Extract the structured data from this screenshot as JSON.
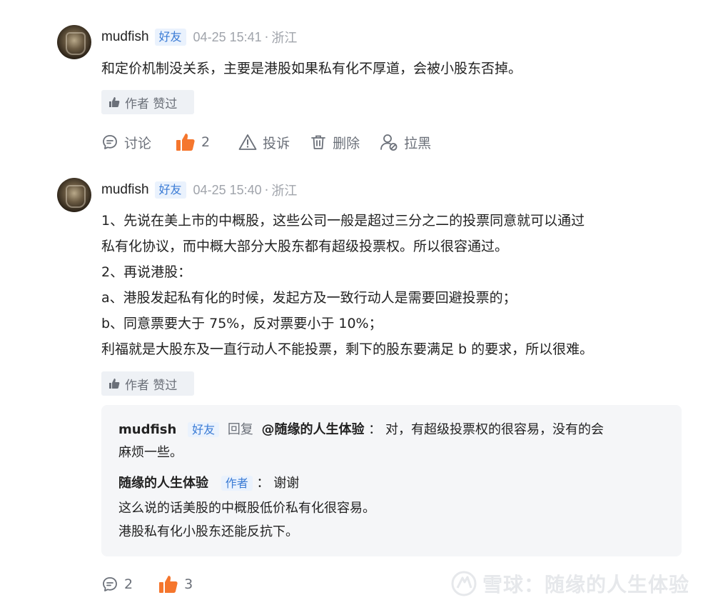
{
  "comments": [
    {
      "username": "mudfish",
      "friend_tag": "好友",
      "timestamp": "04-25 15:41",
      "separator": "·",
      "location": "浙江",
      "lines": [
        "和定价机制没关系，主要是港股如果私有化不厚道，会被小股东否掉。"
      ],
      "author_liked": "作者 赞过",
      "actions": {
        "discuss_label": "讨论",
        "like_count": "2",
        "report_label": "投诉",
        "delete_label": "删除",
        "block_label": "拉黑"
      }
    },
    {
      "username": "mudfish",
      "friend_tag": "好友",
      "timestamp": "04-25 15:40",
      "separator": "·",
      "location": "浙江",
      "lines": [
        "1、先说在美上市的中概股，这些公司一般是超过三分之二的投票同意就可以通过",
        "私有化协议，而中概大部分大股东都有超级投票权。所以很容通过。",
        "2、再说港股：",
        "a、港股发起私有化的时候，发起方及一致行动人是需要回避投票的；",
        "b、同意票要大于 75%，反对票要小于 10%；",
        "利福就是大股东及一直行动人不能投票，剩下的股东要满足 b 的要求，所以很难。"
      ],
      "author_liked": "作者 赞过",
      "replies": [
        {
          "username": "mudfish",
          "friend_tag": "好友",
          "reply_word": "回复",
          "reply_to": "@随缘的人生体验",
          "colon": "：",
          "line1": "对，有超级投票权的很容易，没有的会",
          "line2": "麻烦一些。"
        },
        {
          "username": "随缘的人生体验",
          "author_tag": "作者",
          "colon": "：",
          "line1": "谢谢",
          "line2": "这么说的话美股的中概股低价私有化很容易。",
          "line3": "港股私有化小股东还能反抗下。"
        }
      ],
      "actions": {
        "discuss_count": "2",
        "like_count": "3"
      }
    }
  ],
  "watermark": {
    "text": "雪球：随缘的人生体验"
  },
  "colors": {
    "accent_orange": "#f5762d",
    "tag_blue": "#3a7bd5",
    "meta_gray": "#a0a4ab"
  },
  "icons": [
    "comment-icon",
    "thumbs-up-icon",
    "warning-icon",
    "trash-icon",
    "block-user-icon",
    "snowball-logo-icon"
  ]
}
